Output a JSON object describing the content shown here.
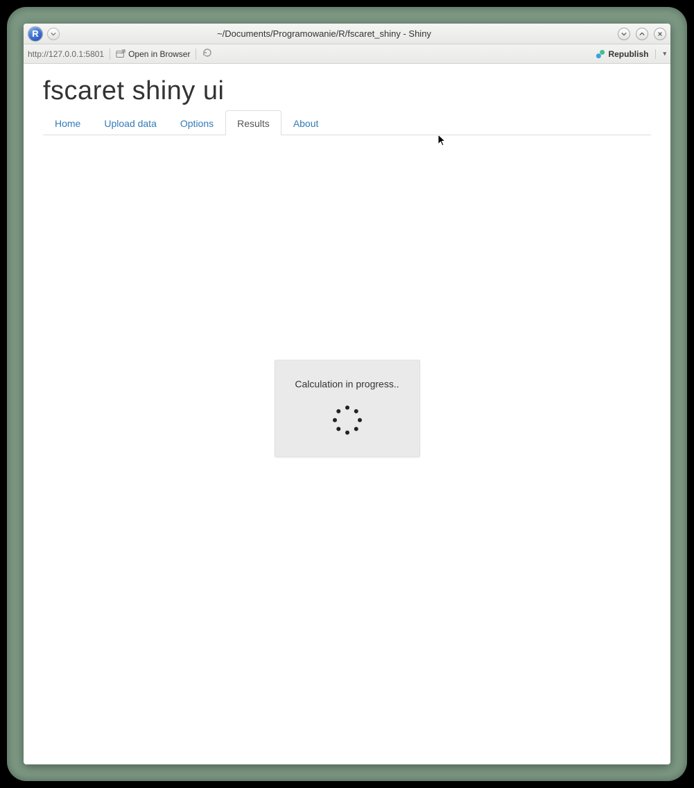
{
  "titlebar": {
    "title": "~/Documents/Programowanie/R/fscaret_shiny - Shiny",
    "r_logo_letter": "R"
  },
  "toolbar": {
    "url": "http://127.0.0.1:5801",
    "open_browser_label": "Open in Browser",
    "republish_label": "Republish"
  },
  "page": {
    "title": "fscaret shiny ui",
    "tabs": [
      {
        "label": "Home",
        "active": false
      },
      {
        "label": "Upload data",
        "active": false
      },
      {
        "label": "Options",
        "active": false
      },
      {
        "label": "Results",
        "active": true
      },
      {
        "label": "About",
        "active": false
      }
    ],
    "progress_text": "Calculation in progress.."
  }
}
